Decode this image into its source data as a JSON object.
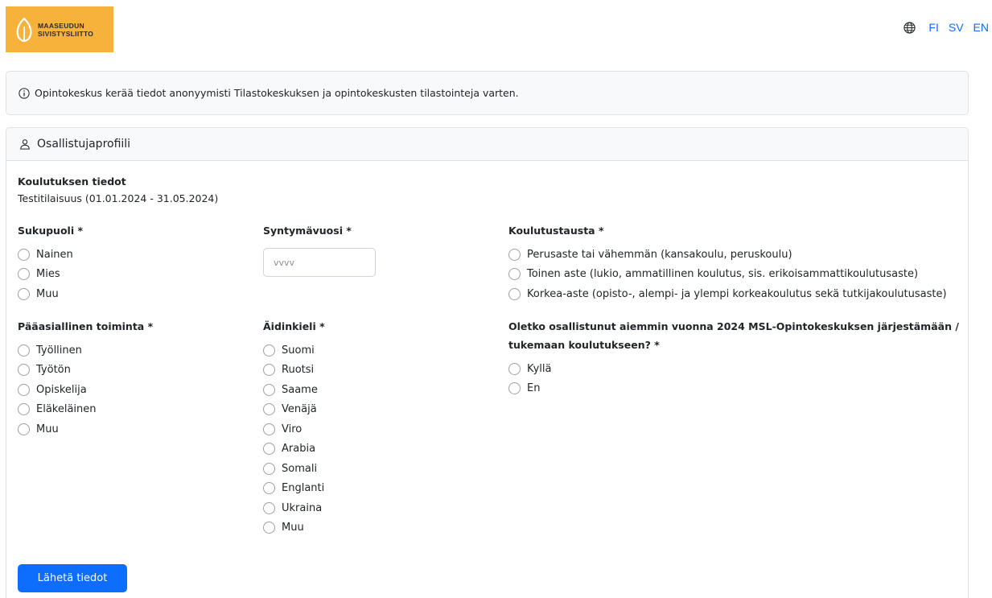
{
  "logo": {
    "line1": "MAASEUDUN",
    "line2": "SIVISTYSLIITTO"
  },
  "languages": [
    "FI",
    "SV",
    "EN"
  ],
  "info": {
    "text": "Opintokeskus kerää tiedot anonyymisti Tilastokeskuksen ja opintokeskusten tilastointeja varten."
  },
  "profile": {
    "title": "Osallistujaprofiili",
    "course_heading": "Koulutuksen tiedot",
    "course_name": "Testitilaisuus (01.01.2024 - 31.05.2024)"
  },
  "gender": {
    "label": "Sukupuoli *",
    "options": [
      "Nainen",
      "Mies",
      "Muu"
    ]
  },
  "birth_year": {
    "label": "Syntymävuosi *",
    "placeholder": "vvvv",
    "value": ""
  },
  "education": {
    "label": "Koulutustausta *",
    "options": [
      "Perusaste tai vähemmän (kansakoulu, peruskoulu)",
      "Toinen aste (lukio, ammatillinen koulutus, sis. erikoisammattikoulutusaste)",
      "Korkea-aste (opisto-, alempi- ja ylempi korkeakoulutus sekä tutkijakoulutusaste)"
    ]
  },
  "activity": {
    "label": "Pääasiallinen toiminta *",
    "options": [
      "Työllinen",
      "Työtön",
      "Opiskelija",
      "Eläkeläinen",
      "Muu"
    ]
  },
  "language": {
    "label": "Äidinkieli *",
    "options": [
      "Suomi",
      "Ruotsi",
      "Saame",
      "Venäjä",
      "Viro",
      "Arabia",
      "Somali",
      "Englanti",
      "Ukraina",
      "Muu"
    ]
  },
  "previous": {
    "label_line1": "Oletko osallistunut aiemmin vuonna 2024 MSL-Opintokeskuksen järjestämään /",
    "label_line2": "tukemaan koulutukseen? *",
    "options": [
      "Kyllä",
      "En"
    ]
  },
  "submit_label": "Lähetä tiedot",
  "colors": {
    "accent": "#0d6efd",
    "logo_bg": "#f7b23b",
    "panel_bg": "#f8f9fa",
    "border": "#dee2e6"
  }
}
